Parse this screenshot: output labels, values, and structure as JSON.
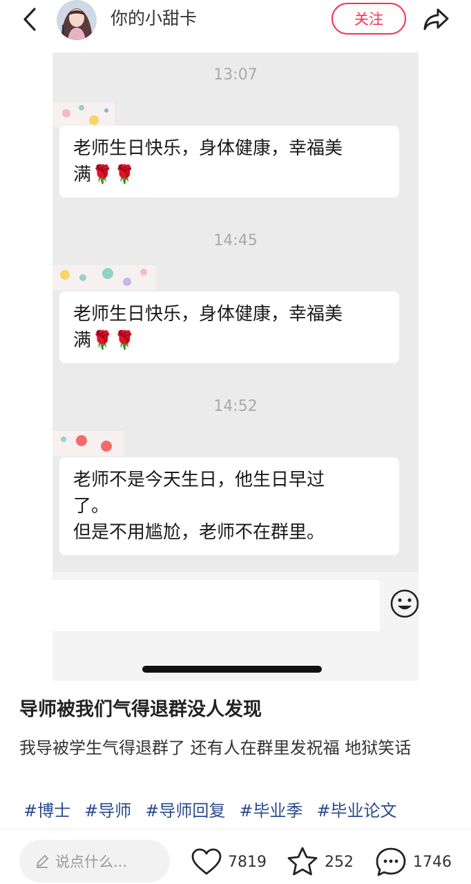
{
  "header": {
    "author_name": "你的小甜卡",
    "follow_label": "关注"
  },
  "chat": {
    "messages": [
      {
        "time": "13:07",
        "lines": [
          "老师生日快乐，身体健康，幸福美",
          "满🌹🌹"
        ]
      },
      {
        "time": "14:45",
        "lines": [
          "老师生日快乐，身体健康，幸福美",
          "满🌹🌹"
        ]
      },
      {
        "time": "14:52",
        "lines": [
          "老师不是今天生日，他生日早过",
          "了。",
          "但是不用尴尬，老师不在群里。"
        ]
      }
    ]
  },
  "post": {
    "title": "导师被我们气得退群没人发现",
    "body": "我导被学生气得退群了 还有人在群里发祝福 地狱笑话",
    "tags": [
      "#博士",
      "#导师",
      "#导师回复",
      "#毕业季",
      "#毕业论文"
    ]
  },
  "bottom_bar": {
    "comment_placeholder": "说点什么...",
    "likes": "7819",
    "collects": "252",
    "comments": "1746"
  },
  "colors": {
    "accent": "#ff2e4d",
    "tag": "#2a4a8c",
    "chat_bg": "#ebebeb"
  },
  "icons": [
    "back-icon",
    "share-icon",
    "emoji-icon",
    "pencil-icon",
    "heart-icon",
    "star-icon",
    "comment-icon"
  ]
}
